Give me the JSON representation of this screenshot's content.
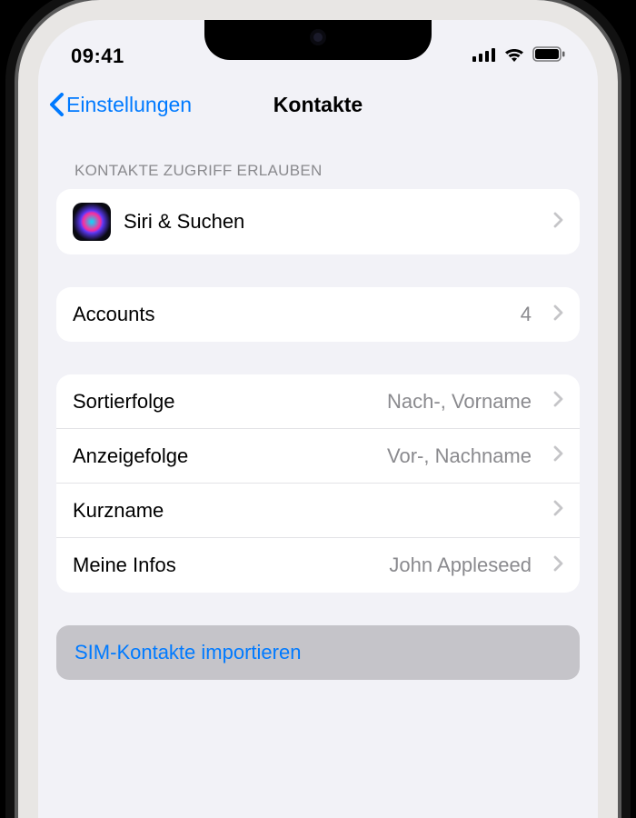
{
  "status": {
    "time": "09:41"
  },
  "nav": {
    "back": "Einstellungen",
    "title": "Kontakte"
  },
  "section1": {
    "header": "KONTAKTE ZUGRIFF ERLAUBEN",
    "siri": "Siri & Suchen"
  },
  "section2": {
    "accounts_label": "Accounts",
    "accounts_count": "4"
  },
  "section3": {
    "sort_label": "Sortierfolge",
    "sort_value": "Nach-, Vorname",
    "display_label": "Anzeigefolge",
    "display_value": "Vor-, Nachname",
    "short_label": "Kurzname",
    "me_label": "Meine Infos",
    "me_value": "John Appleseed"
  },
  "action": {
    "import_sim": "SIM-Kontakte importieren"
  }
}
